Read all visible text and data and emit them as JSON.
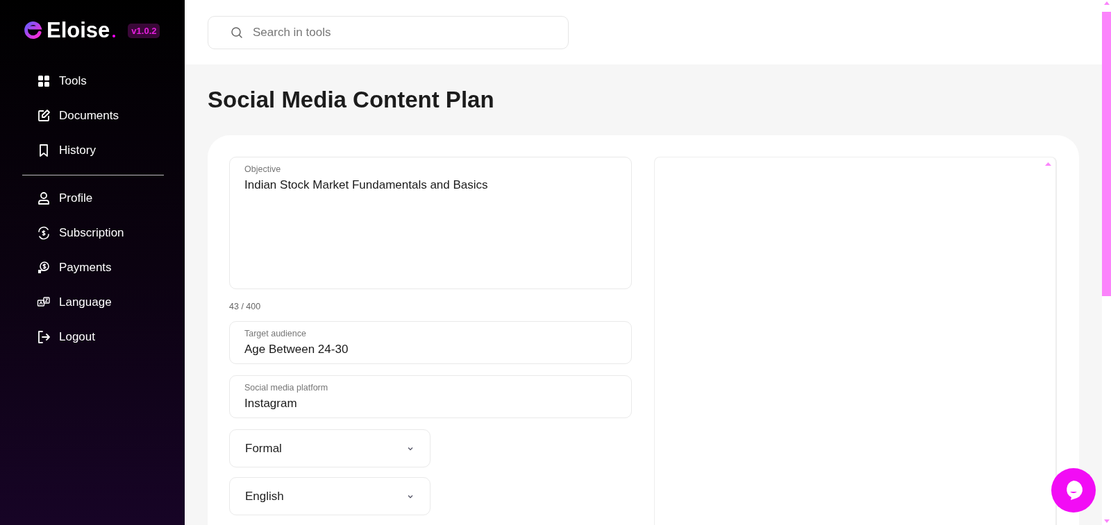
{
  "brand": {
    "name": "Eloise",
    "version": "v1.0.2"
  },
  "sidebar": {
    "items": [
      {
        "label": "Tools",
        "kind": "grid"
      },
      {
        "label": "Documents",
        "kind": "edit"
      },
      {
        "label": "History",
        "kind": "bookmark"
      }
    ],
    "account_items": [
      {
        "label": "Profile",
        "kind": "user"
      },
      {
        "label": "Subscription",
        "kind": "subscription"
      },
      {
        "label": "Payments",
        "kind": "payment"
      },
      {
        "label": "Language",
        "kind": "language"
      },
      {
        "label": "Logout",
        "kind": "logout"
      }
    ]
  },
  "search": {
    "placeholder": "Search in tools"
  },
  "page_title": "Social Media Content Plan",
  "form": {
    "objective": {
      "label": "Objective",
      "value": "Indian Stock Market Fundamentals and Basics",
      "counter": "43 / 400"
    },
    "fields": [
      {
        "label": "Target audience",
        "value": "Age Between 24-30"
      },
      {
        "label": "Social media platform",
        "value": "Instagram"
      }
    ],
    "dropdowns": [
      {
        "value": "Formal"
      },
      {
        "value": "English"
      }
    ]
  }
}
